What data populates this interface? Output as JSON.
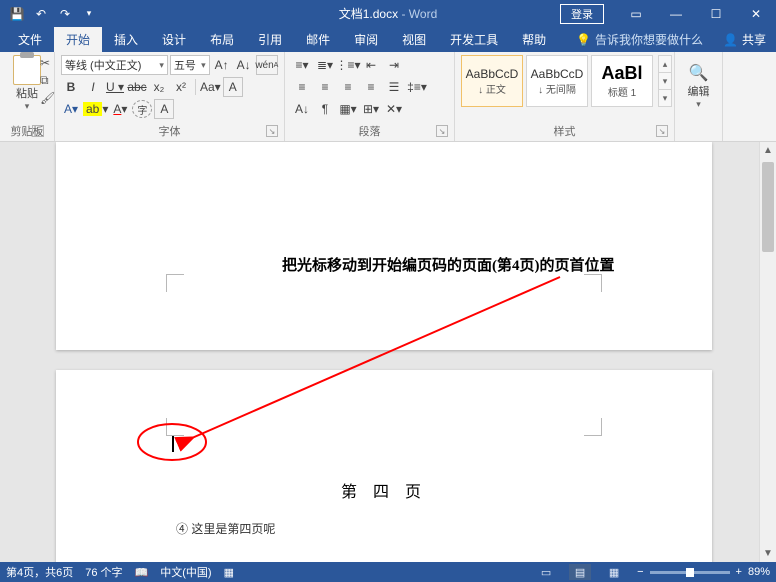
{
  "titlebar": {
    "filename": "文档1.docx",
    "appname": "Word",
    "login": "登录"
  },
  "tabs": {
    "items": [
      {
        "label": "文件"
      },
      {
        "label": "开始"
      },
      {
        "label": "插入"
      },
      {
        "label": "设计"
      },
      {
        "label": "布局"
      },
      {
        "label": "引用"
      },
      {
        "label": "邮件"
      },
      {
        "label": "审阅"
      },
      {
        "label": "视图"
      },
      {
        "label": "开发工具"
      },
      {
        "label": "帮助"
      }
    ],
    "active_index": 1,
    "tellme": "告诉我你想要做什么",
    "share": "共享"
  },
  "ribbon": {
    "clipboard": {
      "paste": "粘贴",
      "label": "剪贴板"
    },
    "font": {
      "family": "等线 (中文正文)",
      "size": "五号",
      "label": "字体"
    },
    "paragraph": {
      "label": "段落"
    },
    "styles": {
      "label": "样式",
      "items": [
        {
          "sample": "AaBbCcD",
          "name": "↓ 正文"
        },
        {
          "sample": "AaBbCcD",
          "name": "↓ 无间隔"
        },
        {
          "sample": "AaBl",
          "name": "标题 1"
        }
      ]
    },
    "edit": {
      "label": "编辑"
    }
  },
  "document": {
    "annotation": "把光标移动到开始编页码的页面(第4页)的页首位置",
    "page2_title": "第 四 页",
    "page2_footer": "④ 这里是第四页呢"
  },
  "status": {
    "page": "第4页，共6页",
    "words": "76 个字",
    "lang": "中文(中国)",
    "zoom": "89%"
  }
}
